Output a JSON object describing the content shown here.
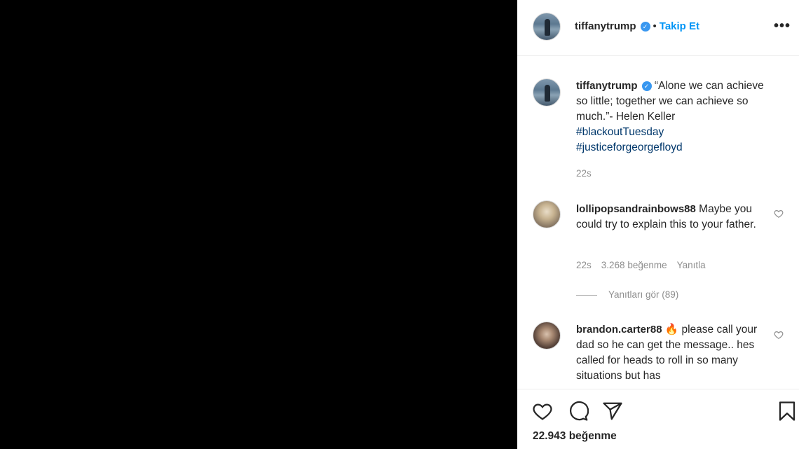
{
  "header": {
    "username": "tiffanytrump",
    "separator": "•",
    "follow_label": "Takip Et",
    "more_label": "•••"
  },
  "caption": {
    "username": "tiffanytrump",
    "text": "“Alone we can achieve so little; together we can achieve so much.”- Helen Keller",
    "hashtags": [
      "#blackoutTuesday",
      "#justiceforgeorgefloyd"
    ],
    "time": "22s"
  },
  "comments": [
    {
      "username": "lollipopsandrainbows88",
      "text": "Maybe you could try to explain this to your father.",
      "time": "22s",
      "likes": "3.268 beğenme",
      "reply_label": "Yanıtla",
      "view_replies": "Yanıtları gör (89)"
    },
    {
      "username": "brandon.carter88",
      "emoji": "🔥",
      "text": "please call your dad so he can get the message.. hes called for heads to roll in so many situations but has"
    }
  ],
  "footer": {
    "likes": "22.943 beğenme"
  },
  "icons": [
    "verified-badge-icon",
    "more-options-icon",
    "heart-icon",
    "comment-icon",
    "share-icon",
    "bookmark-icon"
  ],
  "colors": {
    "accent": "#0095f6",
    "verified": "#3897f0",
    "hashtag": "#00376b",
    "muted": "#8e8e8e",
    "media_background": "#000000"
  }
}
